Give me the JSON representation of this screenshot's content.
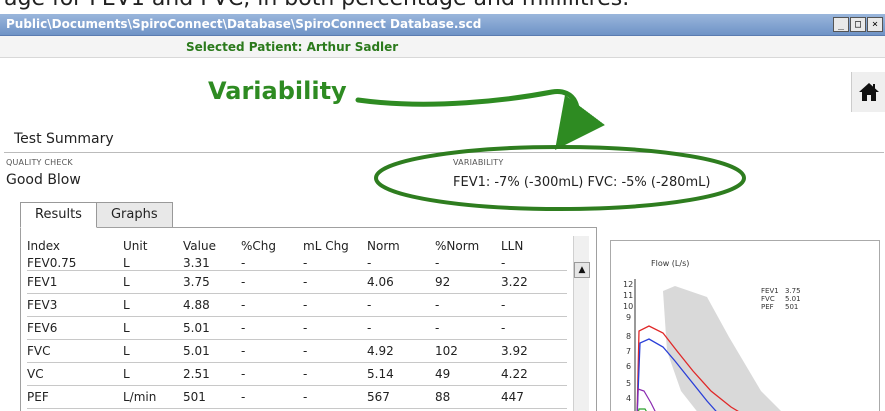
{
  "caption": "age for FEV1 and FVC, in both percentage and millilitres.",
  "window": {
    "title": "Public\\Documents\\SpiroConnect\\Database\\SpiroConnect Database.scd",
    "buttons": [
      "_",
      "□",
      "×"
    ]
  },
  "patient": {
    "label": "Selected Patient: Arthur Sadler"
  },
  "annotation": {
    "label": "Variability",
    "color": "#2e8b22"
  },
  "icons": {
    "home": "home-icon"
  },
  "summary": {
    "title": "Test Summary",
    "quality_check_label": "QUALITY CHECK",
    "quality_check_value": "Good Blow",
    "variability_label": "VARIABILITY",
    "variability_value": "FEV1: -7% (-300mL) FVC: -5% (-280mL)"
  },
  "tabs": [
    {
      "label": "Results",
      "active": true
    },
    {
      "label": "Graphs",
      "active": false
    }
  ],
  "results": {
    "columns": [
      "Index",
      "Unit",
      "Value",
      "%Chg",
      "mL Chg",
      "Norm",
      "%Norm",
      "LLN"
    ],
    "rows": [
      [
        "FEV0.75",
        "L",
        "3.31",
        "-",
        "-",
        "-",
        "-",
        "-"
      ],
      [
        "FEV1",
        "L",
        "3.75",
        "-",
        "-",
        "4.06",
        "92",
        "3.22"
      ],
      [
        "FEV3",
        "L",
        "4.88",
        "-",
        "-",
        "-",
        "-",
        "-"
      ],
      [
        "FEV6",
        "L",
        "5.01",
        "-",
        "-",
        "-",
        "-",
        "-"
      ],
      [
        "FVC",
        "L",
        "5.01",
        "-",
        "-",
        "4.92",
        "102",
        "3.92"
      ],
      [
        "VC",
        "L",
        "2.51",
        "-",
        "-",
        "5.14",
        "49",
        "4.22"
      ],
      [
        "PEF",
        "L/min",
        "501",
        "-",
        "-",
        "567",
        "88",
        "447"
      ]
    ]
  },
  "graph": {
    "title": "Flow (L/s)",
    "y_ticks": [
      "12",
      "11",
      "10",
      "9",
      "8",
      "7",
      "6",
      "5",
      "4"
    ],
    "legend": [
      {
        "name": "FEV1",
        "value": "3.75"
      },
      {
        "name": "FVC",
        "value": "5.01"
      },
      {
        "name": "PEF",
        "value": "501"
      }
    ],
    "colors": {
      "red": "#e02828",
      "blue": "#2a3fd8",
      "purple": "#8a2ab0",
      "green": "#2aa02a",
      "band": "#d8d8d8"
    }
  }
}
